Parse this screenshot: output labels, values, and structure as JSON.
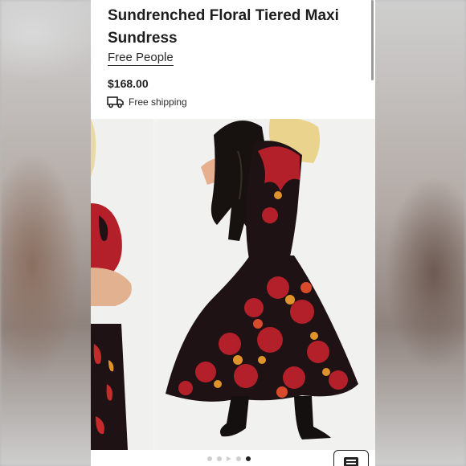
{
  "product": {
    "title": "Sundrenched Floral Tiered Maxi Sundress",
    "brand": "Free People",
    "price": "$168.00",
    "shipping": "Free shipping"
  },
  "gallery": {
    "image_count": 5,
    "active_index": 4,
    "video_index": 2
  },
  "icons": {
    "shipping": "truck-icon",
    "chat": "message-icon"
  },
  "colors": {
    "dress_red": "#b3202a",
    "dress_dark": "#1e1214",
    "accent_black": "#222222"
  }
}
